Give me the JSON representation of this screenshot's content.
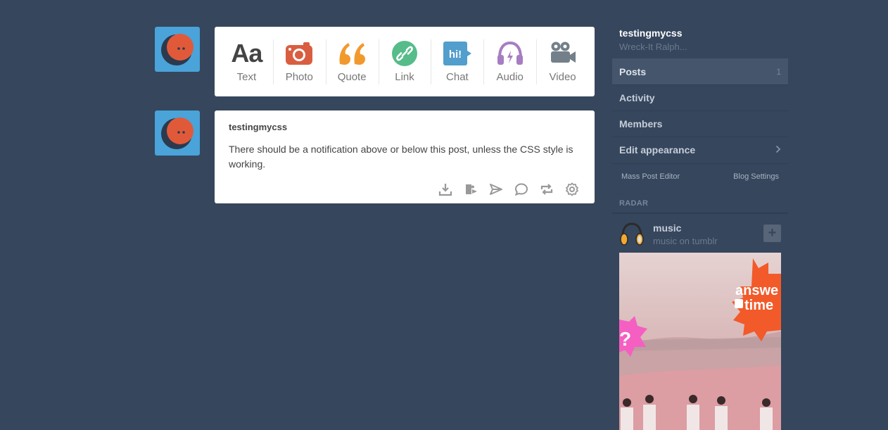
{
  "post_types": [
    {
      "label": "Text",
      "icon": "text-icon",
      "color": "#444444"
    },
    {
      "label": "Photo",
      "icon": "camera-icon",
      "color": "#d95e40"
    },
    {
      "label": "Quote",
      "icon": "quote-icon",
      "color": "#f2992e"
    },
    {
      "label": "Link",
      "icon": "link-icon",
      "color": "#56bc8a"
    },
    {
      "label": "Chat",
      "icon": "chat-icon",
      "color": "#529ecc"
    },
    {
      "label": "Audio",
      "icon": "headphones-icon",
      "color": "#a77dc2"
    },
    {
      "label": "Video",
      "icon": "video-camera-icon",
      "color": "#748089"
    }
  ],
  "post": {
    "author": "testingmycss",
    "body": "There should be a notification above or below this post, unless the CSS style is working.",
    "actions": [
      "download-icon",
      "puzzle-icon",
      "send-icon",
      "reply-icon",
      "reblog-icon",
      "gear-icon"
    ]
  },
  "sidebar": {
    "blog_name": "testingmycss",
    "blog_desc": "Wreck-It Ralph...",
    "menu": [
      {
        "label": "Posts",
        "count": "1"
      },
      {
        "label": "Activity"
      },
      {
        "label": "Members"
      },
      {
        "label": "Edit appearance"
      }
    ],
    "links": {
      "left": "Mass Post Editor",
      "right": "Blog Settings"
    },
    "radar": {
      "title": "RADAR",
      "blog_name": "music",
      "blog_desc": "music on tumblr",
      "follow": "+",
      "image_text": [
        "answe",
        "time",
        "?"
      ]
    }
  },
  "colors": {
    "dashboard_bg": "#36465d",
    "avatar_bg": "#4aa3d9",
    "accent_orange": "#e05a3a"
  }
}
